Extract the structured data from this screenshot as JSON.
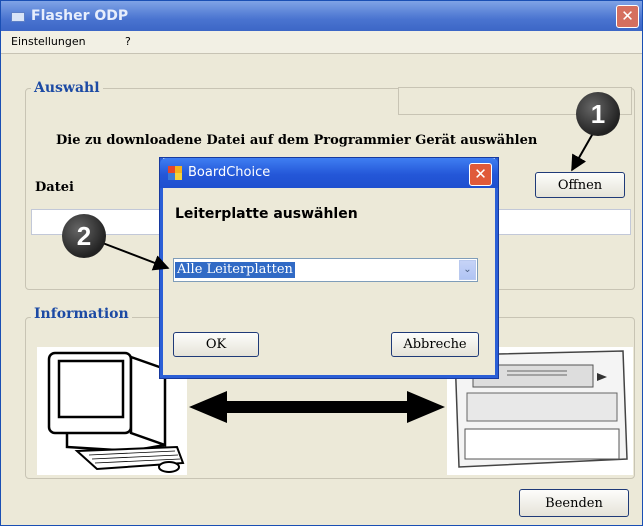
{
  "window": {
    "title": "Flasher ODP",
    "close_glyph": "✕"
  },
  "menu": {
    "items": [
      {
        "label": "Einstellungen"
      },
      {
        "label": "?"
      }
    ]
  },
  "auswahl": {
    "group_label": "Auswahl",
    "instruction": "Die zu downloadene Datei auf dem Programmier Gerät auswählen",
    "file_label": "Datei",
    "file_path_value": "",
    "open_button": "Offnen"
  },
  "information": {
    "group_label": "Information"
  },
  "footer": {
    "exit_button": "Beenden"
  },
  "dialog": {
    "title": "BoardChoice",
    "close_glyph": "✕",
    "prompt": "Leiterplatte auswählen",
    "combo_selected": "Alle Leiterplatten",
    "combo_arrow": "⌄",
    "ok_button": "OK",
    "cancel_button": "Abbreche"
  },
  "callouts": [
    {
      "number": "1"
    },
    {
      "number": "2"
    }
  ],
  "colors": {
    "titlebar": "#4a74d0",
    "dialog_titlebar": "#2457d8",
    "selection": "#316ac5",
    "group_label": "#1c4aa4"
  },
  "icons": [
    "app-icon",
    "close-icon",
    "dropdown-arrow-icon",
    "computer-illustration",
    "device-illustration",
    "double-arrow-icon"
  ]
}
